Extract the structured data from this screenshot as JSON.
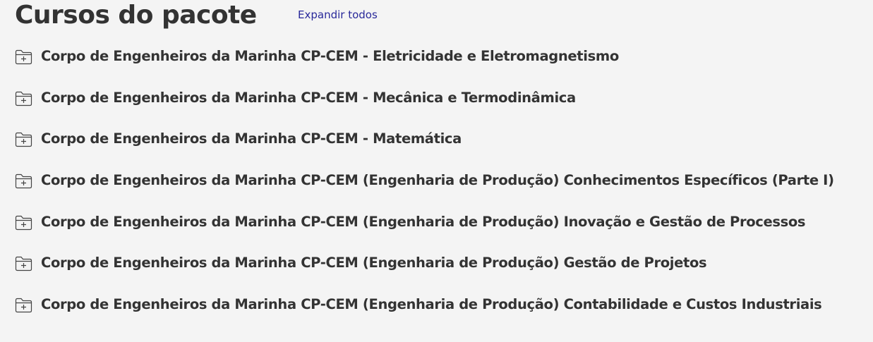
{
  "header": {
    "title": "Cursos do pacote",
    "expand_all_label": "Expandir todos"
  },
  "courses": [
    {
      "label": "Corpo de Engenheiros da Marinha CP-CEM - Eletricidade e Eletromagnetismo",
      "icon": "folder-plus-icon"
    },
    {
      "label": "Corpo de Engenheiros da Marinha CP-CEM - Mecânica e Termodinâmica",
      "icon": "folder-plus-icon"
    },
    {
      "label": "Corpo de Engenheiros da Marinha CP-CEM - Matemática",
      "icon": "folder-plus-icon"
    },
    {
      "label": "Corpo de Engenheiros da Marinha CP-CEM (Engenharia de Produção) Conhecimentos Específicos (Parte I)",
      "icon": "folder-plus-icon"
    },
    {
      "label": "Corpo de Engenheiros da Marinha CP-CEM (Engenharia de Produção) Inovação e Gestão de Processos",
      "icon": "folder-plus-icon"
    },
    {
      "label": "Corpo de Engenheiros da Marinha CP-CEM (Engenharia de Produção) Gestão de Projetos",
      "icon": "folder-plus-icon"
    },
    {
      "label": "Corpo de Engenheiros da Marinha CP-CEM (Engenharia de Produção) Contabilidade e Custos Industriais",
      "icon": "folder-plus-icon"
    }
  ],
  "colors": {
    "background": "#f4f4f4",
    "text": "#333333",
    "link": "#29299a"
  }
}
